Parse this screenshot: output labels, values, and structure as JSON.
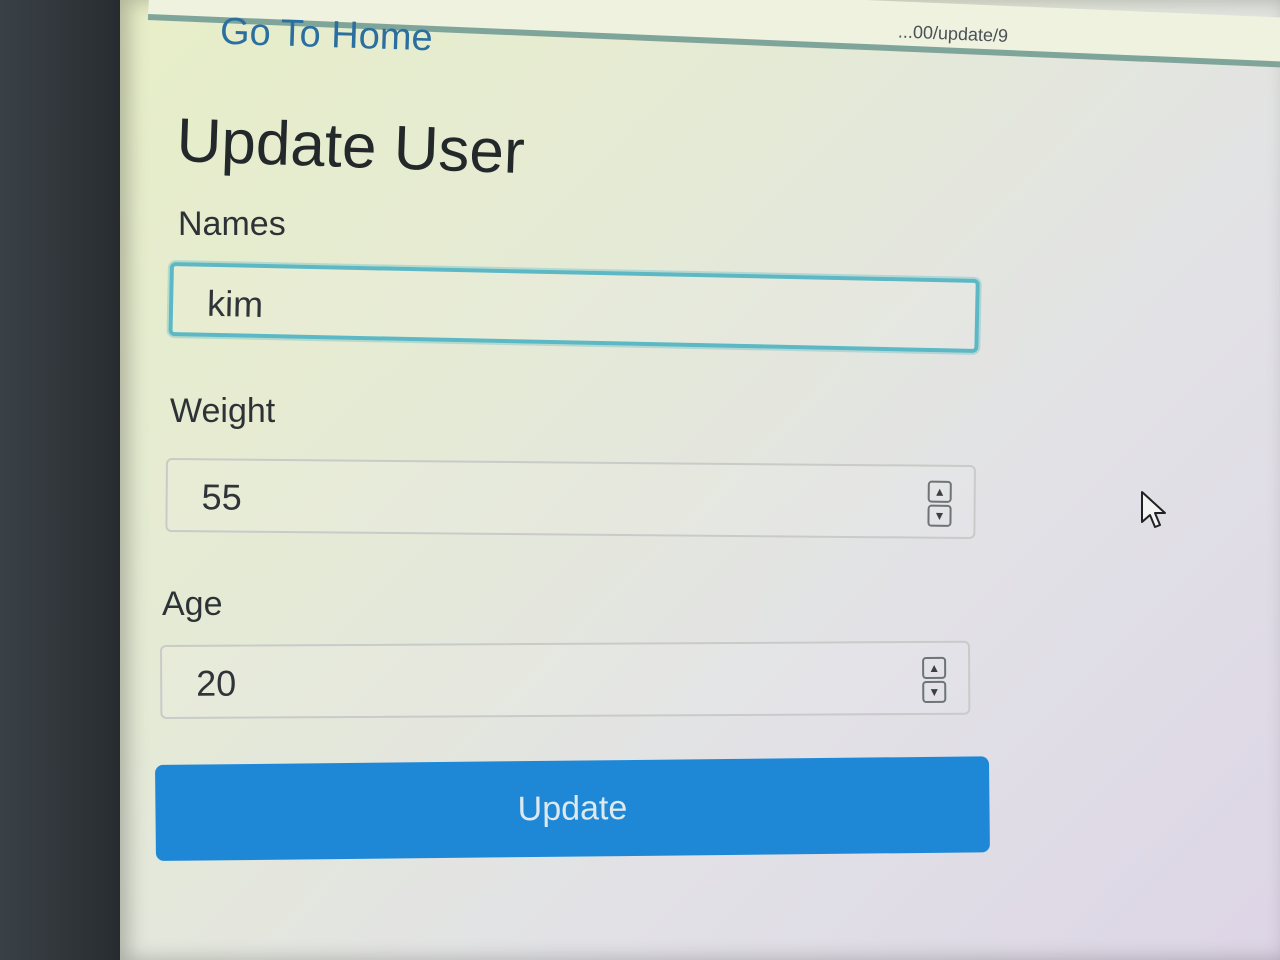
{
  "browser": {
    "url_fragment": "...00/update/9"
  },
  "nav": {
    "home_link": "Go To Home"
  },
  "page": {
    "title": "Update User"
  },
  "form": {
    "names_label": "Names",
    "names_value": "kim",
    "weight_label": "Weight",
    "weight_value": "55",
    "age_label": "Age",
    "age_value": "20",
    "submit_label": "Update"
  },
  "icons": {
    "spin_up": "chevron-up-icon",
    "spin_down": "chevron-down-icon",
    "cursor": "mouse-cursor-icon"
  },
  "colors": {
    "accent": "#1e88d6",
    "focus_ring": "#5bb8c4",
    "link": "#2a6fa0"
  }
}
